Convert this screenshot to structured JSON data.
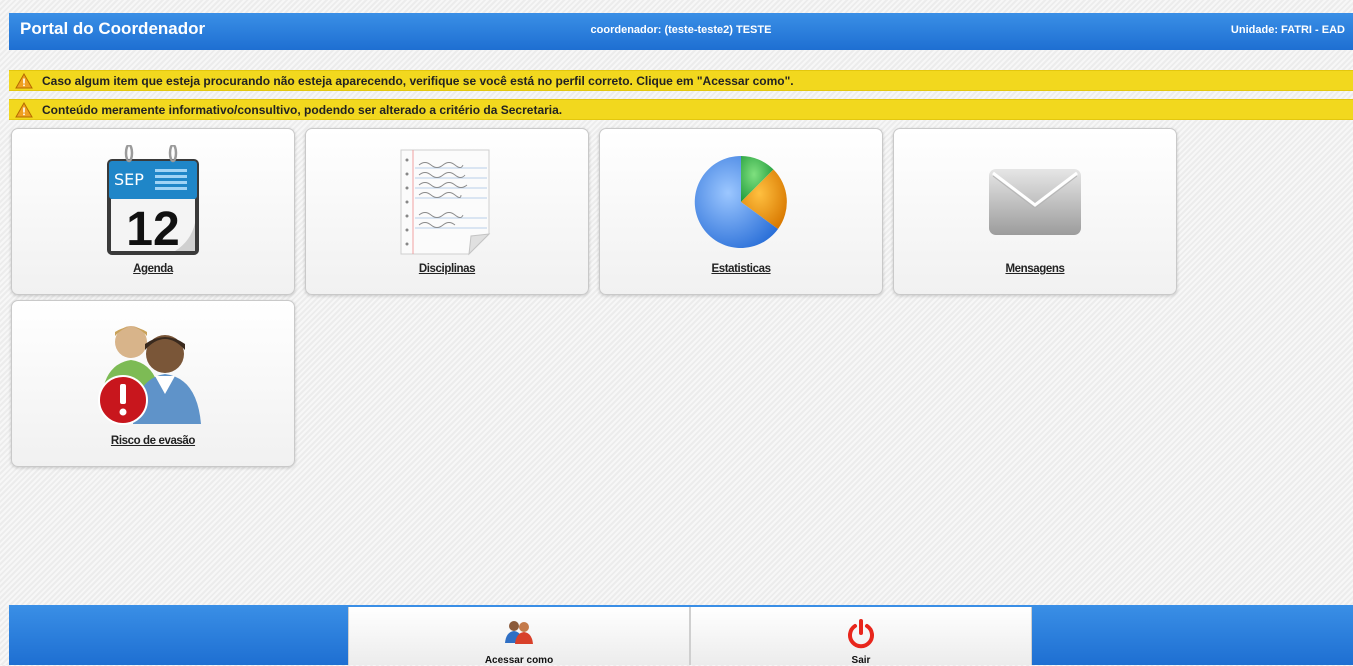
{
  "header": {
    "title": "Portal do Coordenador",
    "user": "coordenador: (teste-teste2) TESTE",
    "unit": "Unidade: FATRI - EAD"
  },
  "alerts": [
    {
      "icon": "warning-icon",
      "text": "Caso algum item que esteja procurando não esteja aparecendo, verifique se você está no perfil correto. Clique em \"Acessar como\"."
    },
    {
      "icon": "warning-icon",
      "text": "Conteúdo meramente informativo/consultivo, podendo ser alterado a critério da Secretaria."
    }
  ],
  "tiles": [
    {
      "label": "Agenda",
      "icon": "calendar-icon",
      "calendar": {
        "month": "SEP",
        "day": "12"
      }
    },
    {
      "label": "Disciplinas",
      "icon": "notepad-icon"
    },
    {
      "label": "Estatisticas",
      "icon": "pie-chart-icon"
    },
    {
      "label": "Mensagens",
      "icon": "envelope-icon"
    },
    {
      "label": "Risco de evasão",
      "icon": "users-alert-icon"
    }
  ],
  "footer": {
    "acessar_label": "Acessar como",
    "sair_label": "Sair"
  },
  "colors": {
    "header": "#2a7fde",
    "alert": "#f2d81e",
    "sair": "#e8261c"
  }
}
